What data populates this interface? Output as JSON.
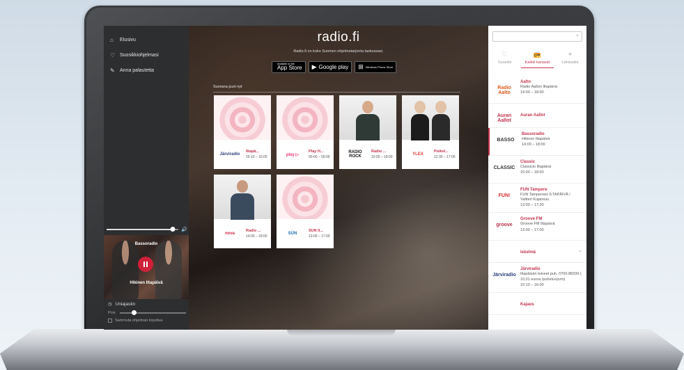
{
  "sidebar": {
    "items": [
      {
        "icon": "home-icon",
        "glyph": "⌂",
        "label": "Etusivu"
      },
      {
        "icon": "heart-icon",
        "glyph": "♡",
        "label": "Suosikkiohjelmasi"
      },
      {
        "icon": "pencil-icon",
        "glyph": "✎",
        "label": "Anna palautetta"
      }
    ],
    "volume": 0.92,
    "player": {
      "station": "Bassoradio",
      "show": "Hikinen Iltapäivä"
    },
    "timer": {
      "title": "Uniajastin",
      "label": "Pois",
      "checkbox": "Sammuta ohjelman loputtua"
    }
  },
  "main": {
    "logo": "radio.fi",
    "tagline": "Radio.fi on koko Suomen ohjelmatarjonta taskussasi.",
    "stores": [
      {
        "small": "Available on the",
        "big": "App Store",
        "icon": "apple-icon"
      },
      {
        "small": "",
        "big": "Google play",
        "icon": "play-store-icon"
      },
      {
        "small": "",
        "big": "Windows Phone Store",
        "icon": "windows-icon"
      }
    ],
    "section_title": "Suorana juuri nyt",
    "cards": [
      {
        "logo": "Järviradio",
        "logo_color": "#2a3f7a",
        "name": "Iltapä...",
        "time": "15:10 – 16:00",
        "img": "pink"
      },
      {
        "logo": "play ▷",
        "logo_color": "#e6356f",
        "name": "Play H...",
        "time": "00:00 – 00:00",
        "img": "pink"
      },
      {
        "logo": "RADIO ROCK",
        "logo_color": "#111111",
        "name": "Radio ...",
        "time": "15:00 – 18:00",
        "img": "photo-single"
      },
      {
        "logo": "YLEX",
        "logo_color": "#e23a3a",
        "name": "Poikel...",
        "time": "12:30 – 17:00",
        "img": "photo-duo"
      },
      {
        "logo": "nova",
        "logo_color": "#d4234b",
        "name": "Radio ...",
        "time": "14:00 – 18:00",
        "img": "photo-single2"
      },
      {
        "logo": "SÜN",
        "logo_color": "#1f6fb5",
        "name": "SUN II...",
        "time": "13:00 – 17:00",
        "img": "pink"
      }
    ]
  },
  "right": {
    "search_placeholder": "",
    "tabs": [
      {
        "icon": "heart-icon",
        "glyph": "♡",
        "label": "Suosikit",
        "active": false
      },
      {
        "icon": "radio-icon",
        "glyph": "📻",
        "label": "Kaikki kanavat",
        "active": true
      },
      {
        "icon": "location-icon",
        "glyph": "⌖",
        "label": "Lähiradiot",
        "active": false
      }
    ],
    "channels": [
      {
        "logo": "Radio Aalto",
        "logo_color": "#e05a1c",
        "name": "Aalto",
        "desc": "Radio Aallon Iltapäivä",
        "time": "14:00 – 18:00",
        "active": false
      },
      {
        "logo": "Auran Aallot",
        "logo_color": "#c2334d",
        "name": "Auran Aallot",
        "desc": "",
        "time": "",
        "active": false
      },
      {
        "logo": "BASSO",
        "logo_color": "#333333",
        "name": "Bassoradio",
        "desc": "Hikinen Iltapäivä",
        "time": "14:00 – 18:00",
        "active": true
      },
      {
        "logo": "CLASSIC",
        "logo_color": "#333333",
        "name": "Classic",
        "desc": "Classicin Iltapäivä",
        "time": "15:00 – 18:00",
        "active": false
      },
      {
        "logo": "FUN!",
        "logo_color": "#d62828",
        "name": "FUN Tampere",
        "desc": "FUN Tampereen ILTAPÄIVÄ / Valtteri Kujansuu",
        "time": "13:00 – 17:30",
        "active": false
      },
      {
        "logo": "groove",
        "logo_color": "#b8304a",
        "name": "Groove FM",
        "desc": "Groove FM Iltapäivä",
        "time": "13:00 – 17:00",
        "active": false
      },
      {
        "logo": "",
        "logo_color": "#333333",
        "name": "Iskelmä",
        "desc": "",
        "time": "",
        "active": false,
        "expand": true
      },
      {
        "logo": "Järviradio",
        "logo_color": "#2a3f7a",
        "name": "Järviradio",
        "desc": "Iltapäivän toiveet puh. 0700-88200 ( 10,01 euroa /puhelu+pvm)",
        "time": "15:10 – 16:00",
        "active": false
      },
      {
        "logo": "",
        "logo_color": "#333333",
        "name": "Kajaus",
        "desc": "",
        "time": "",
        "active": false
      }
    ]
  }
}
